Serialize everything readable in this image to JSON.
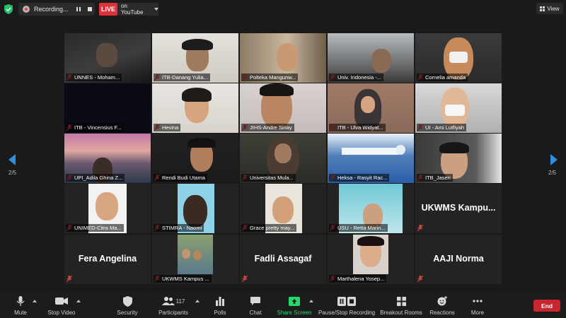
{
  "top_bar": {
    "recording_label": "Recording...",
    "live_label": "LIVE",
    "stream_label": "on YouTube",
    "view_label": "View"
  },
  "navigation": {
    "page_left": "2/5",
    "page_right": "2/5"
  },
  "tiles": [
    {
      "name": "UNNES - Moham...",
      "camera": true
    },
    {
      "name": "ITB-Danang Yulia...",
      "camera": true
    },
    {
      "name": "Polteka Mangunw...",
      "camera": true
    },
    {
      "name": "Univ. Indonesia -...",
      "camera": true
    },
    {
      "name": "Cornelia amanda",
      "camera": true
    },
    {
      "name": "ITB - Vincensius F...",
      "camera": true
    },
    {
      "name": "Hevina",
      "camera": true
    },
    {
      "name": "JIHS-Andre Sinay",
      "camera": true
    },
    {
      "name": "ITB - Ulva Widyat...",
      "camera": true
    },
    {
      "name": "UI - Ami Lutfiyah",
      "camera": true
    },
    {
      "name": "UPI_Adila Ghina Z...",
      "camera": true
    },
    {
      "name": "Rendi Budi Utama",
      "camera": true
    },
    {
      "name": "Universitas Mula...",
      "camera": true
    },
    {
      "name": "Heksa - Rasyit Rac...",
      "camera": true
    },
    {
      "name": "ITB_Jasen",
      "camera": true
    },
    {
      "name": "UNIMED-Citra Ma...",
      "camera": true
    },
    {
      "name": "STIMRA - Naomi",
      "camera": true
    },
    {
      "name": "Grace pretty may...",
      "camera": true
    },
    {
      "name": "USU - Retta Marin...",
      "camera": true
    },
    {
      "name": "UKWMS  Kampu...",
      "camera": false
    },
    {
      "name": "Fera Angelina",
      "camera": false
    },
    {
      "name": "UKWMS Kampus ...",
      "camera": true
    },
    {
      "name": "Fadli Assagaf",
      "camera": false
    },
    {
      "name": "Marthalena Yosep...",
      "camera": true
    },
    {
      "name": "AAJI Norma",
      "camera": false
    }
  ],
  "toolbar": {
    "mute": "Mute",
    "stop_video": "Stop Video",
    "security": "Security",
    "participants": "Participants",
    "participants_count": "117",
    "polls": "Polls",
    "chat": "Chat",
    "share_screen": "Share Screen",
    "pause_recording": "Pause/Stop Recording",
    "breakout_rooms": "Breakout Rooms",
    "reactions": "Reactions",
    "more": "More",
    "end": "End"
  },
  "colors": {
    "live": "#e0313a",
    "accent_blue": "#2f8fdc",
    "share_green": "#23d96b",
    "end_red": "#c8262e",
    "muted_mic_red": "#e5484d"
  }
}
